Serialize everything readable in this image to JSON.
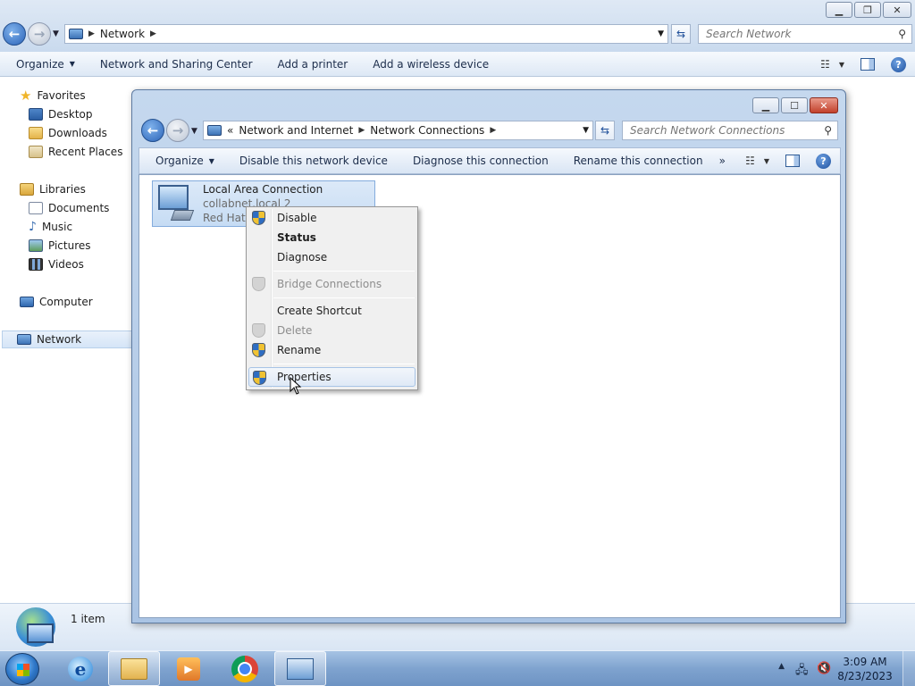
{
  "outer": {
    "address_crumbs": [
      "Network"
    ],
    "search_placeholder": "Search Network",
    "commands": [
      "Organize",
      "Network and Sharing Center",
      "Add a printer",
      "Add a wireless device"
    ],
    "sidebar": {
      "favorites": {
        "label": "Favorites",
        "items": [
          "Desktop",
          "Downloads",
          "Recent Places"
        ]
      },
      "libraries": {
        "label": "Libraries",
        "items": [
          "Documents",
          "Music",
          "Pictures",
          "Videos"
        ]
      },
      "computer": "Computer",
      "network": "Network"
    },
    "status": "1 item"
  },
  "inner": {
    "address_prefix": "«",
    "address_crumbs": [
      "Network and Internet",
      "Network Connections"
    ],
    "search_placeholder": "Search Network Connections",
    "commands": [
      "Organize",
      "Disable this network device",
      "Diagnose this connection",
      "Rename this connection"
    ],
    "more": "»",
    "item": {
      "name": "Local Area Connection",
      "line1": "collabnet.local 2",
      "line2": "Red Hat VirtIO Ethernet Adapter"
    }
  },
  "context_menu": {
    "items": [
      {
        "label": "Disable",
        "shield": true,
        "bold": false,
        "disabled": false
      },
      {
        "label": "Status",
        "shield": false,
        "bold": true,
        "disabled": false
      },
      {
        "label": "Diagnose",
        "shield": false,
        "bold": false,
        "disabled": false
      },
      {
        "label": "Bridge Connections",
        "shield": true,
        "bold": false,
        "disabled": true
      },
      {
        "label": "Create Shortcut",
        "shield": false,
        "bold": false,
        "disabled": false
      },
      {
        "label": "Delete",
        "shield": true,
        "bold": false,
        "disabled": true
      },
      {
        "label": "Rename",
        "shield": true,
        "bold": false,
        "disabled": false
      },
      {
        "label": "Properties",
        "shield": true,
        "bold": false,
        "disabled": false,
        "hover": true
      }
    ]
  },
  "taskbar": {
    "time": "3:09 AM",
    "date": "8/23/2023",
    "pinned": [
      "internet-explorer",
      "windows-explorer",
      "media-player",
      "chrome",
      "network-connections"
    ]
  },
  "colors": {
    "title_gradient_top": "#dfe9f5",
    "selection": "#c6dcf4",
    "taskbar": "#7fa3cf"
  }
}
